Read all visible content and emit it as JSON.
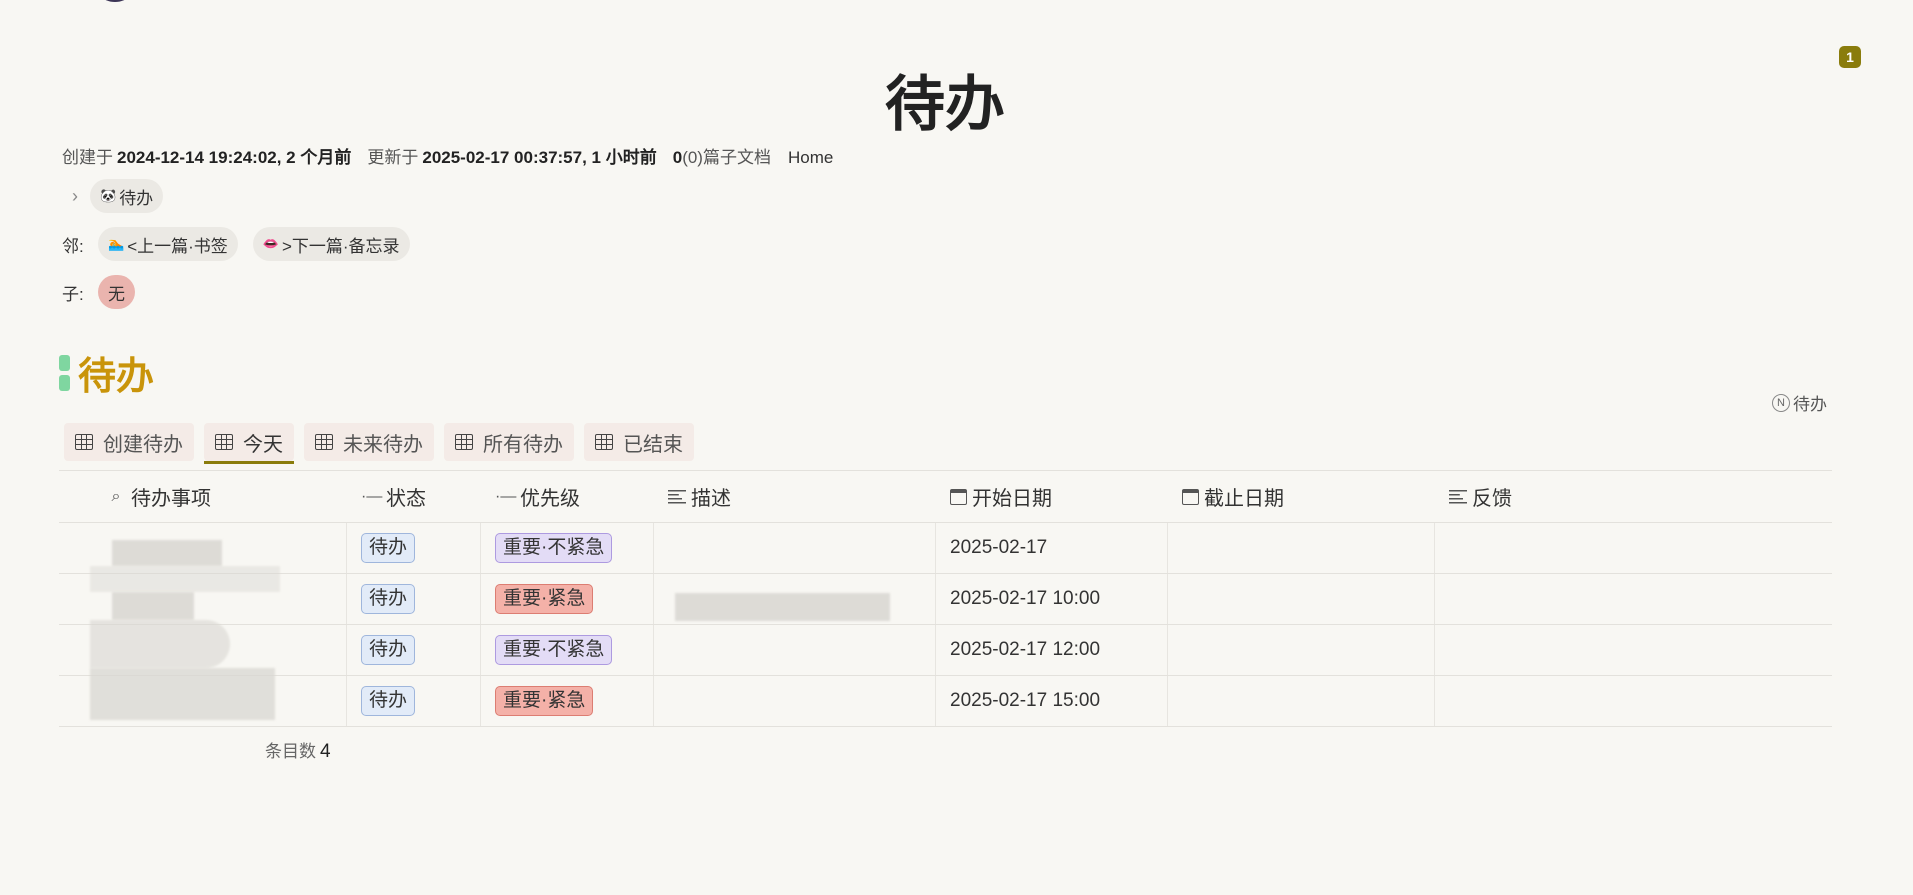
{
  "notification": {
    "count": "1"
  },
  "page": {
    "title": "待办"
  },
  "meta": {
    "created_label": "创建于",
    "created_value": "2024-12-14 19:24:02, 2 个月前",
    "updated_label": "更新于",
    "updated_value": "2025-02-17 00:37:57, 1 小时前",
    "docs_count": "0",
    "docs_paren": "(0)",
    "docs_label": "篇子文档",
    "home_link": "Home"
  },
  "breadcrumb": {
    "item_label": "待办",
    "item_icon": "panda-icon"
  },
  "neighbors": {
    "label": "邻:",
    "prev": "<上一篇·书签",
    "prev_icon": "swimmer-icon",
    "next": ">下一篇·备忘录",
    "next_icon": "lips-icon"
  },
  "children": {
    "label": "子:",
    "value": "无"
  },
  "section": {
    "title": "待办",
    "db_ref": "待办"
  },
  "tabs": [
    {
      "label": "创建待办"
    },
    {
      "label": "今天",
      "active": true
    },
    {
      "label": "未来待办"
    },
    {
      "label": "所有待办"
    },
    {
      "label": "已结束"
    }
  ],
  "table": {
    "columns": {
      "title": "待办事项",
      "status": "状态",
      "priority": "优先级",
      "desc": "描述",
      "start": "开始日期",
      "due": "截止日期",
      "feedback": "反馈"
    },
    "rows": [
      {
        "status": "待办",
        "priority": "重要·不紧急",
        "priority_color": "purple",
        "start": "2025-02-17"
      },
      {
        "status": "待办",
        "priority": "重要·紧急",
        "priority_color": "red",
        "start": "2025-02-17 10:00"
      },
      {
        "status": "待办",
        "priority": "重要·不紧急",
        "priority_color": "purple",
        "start": "2025-02-17 12:00"
      },
      {
        "status": "待办",
        "priority": "重要·紧急",
        "priority_color": "red",
        "start": "2025-02-17 15:00"
      }
    ],
    "count_label": "条目数",
    "count_value": "4"
  },
  "colors": {
    "accent": "#8a7c0c",
    "section_title": "#c9940a",
    "section_bar": "#7fd6a0"
  }
}
